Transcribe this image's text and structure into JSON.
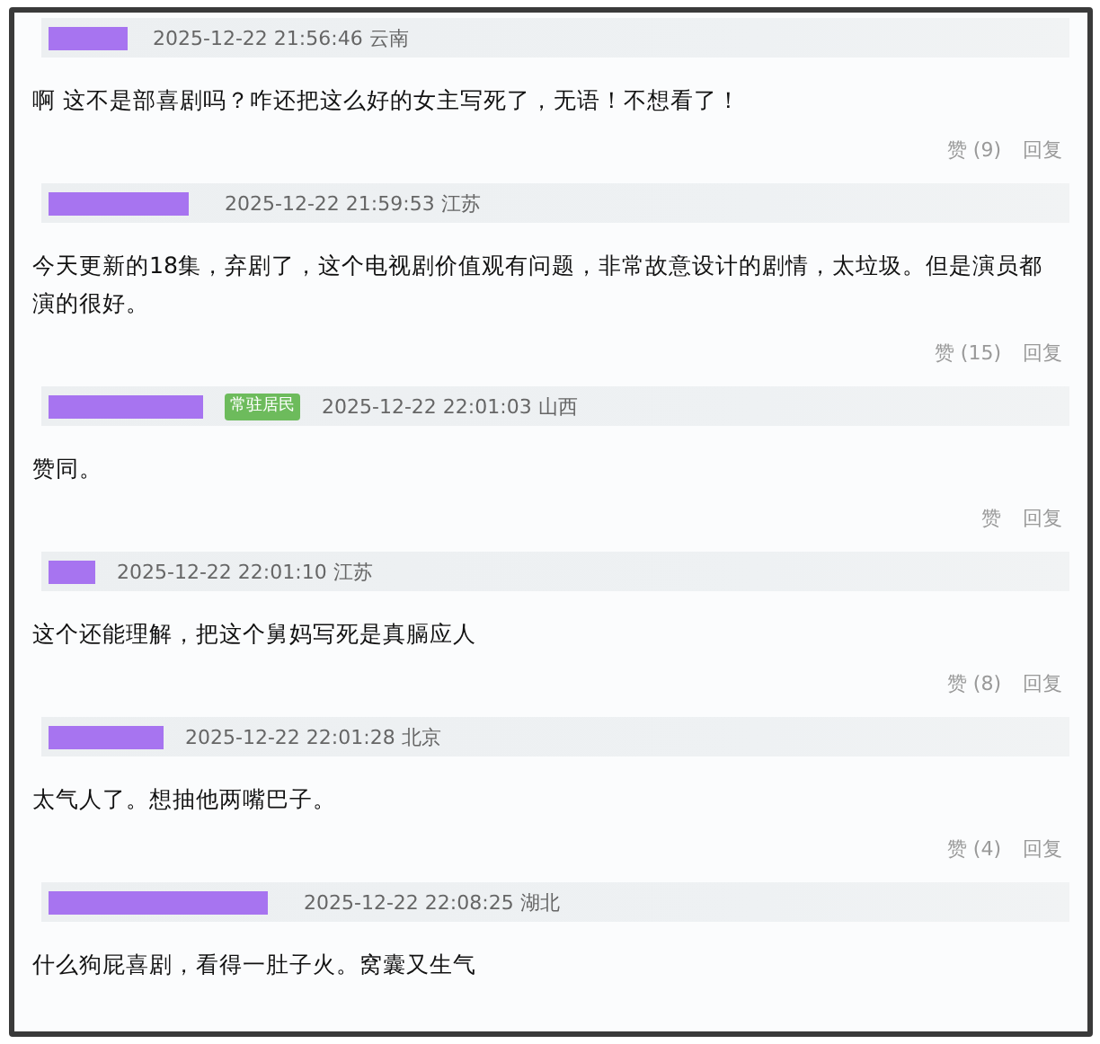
{
  "comments": [
    {
      "name_redacted": true,
      "time": "2025-12-22 21:56:46",
      "location": "云南",
      "text": "啊 这不是部喜剧吗？咋还把这么好的女主写死了，无语！不想看了！",
      "like": "赞 (9)",
      "reply": "回复"
    },
    {
      "name_redacted": true,
      "time": "2025-12-22 21:59:53",
      "location": "江苏",
      "text": "今天更新的18集，弃剧了，这个电视剧价值观有问题，非常故意设计的剧情，太垃圾。但是演员都演的很好。",
      "like": "赞 (15)",
      "reply": "回复"
    },
    {
      "name_redacted": true,
      "badge": "常驻居民",
      "time": "2025-12-22 22:01:03",
      "location": "山西",
      "text": "赞同。",
      "like": "赞",
      "reply": "回复"
    },
    {
      "name_redacted": true,
      "time": "2025-12-22 22:01:10",
      "location": "江苏",
      "text": "这个还能理解，把这个舅妈写死是真膈应人",
      "like": "赞 (8)",
      "reply": "回复"
    },
    {
      "name_redacted": true,
      "time": "2025-12-22 22:01:28",
      "location": "北京",
      "text": "太气人了。想抽他两嘴巴子。",
      "like": "赞 (4)",
      "reply": "回复"
    },
    {
      "name_redacted": true,
      "time": "2025-12-22 22:08:25",
      "location": "湖北",
      "text": "什么狗屁喜剧，看得一肚子火。窝囊又生气"
    }
  ]
}
